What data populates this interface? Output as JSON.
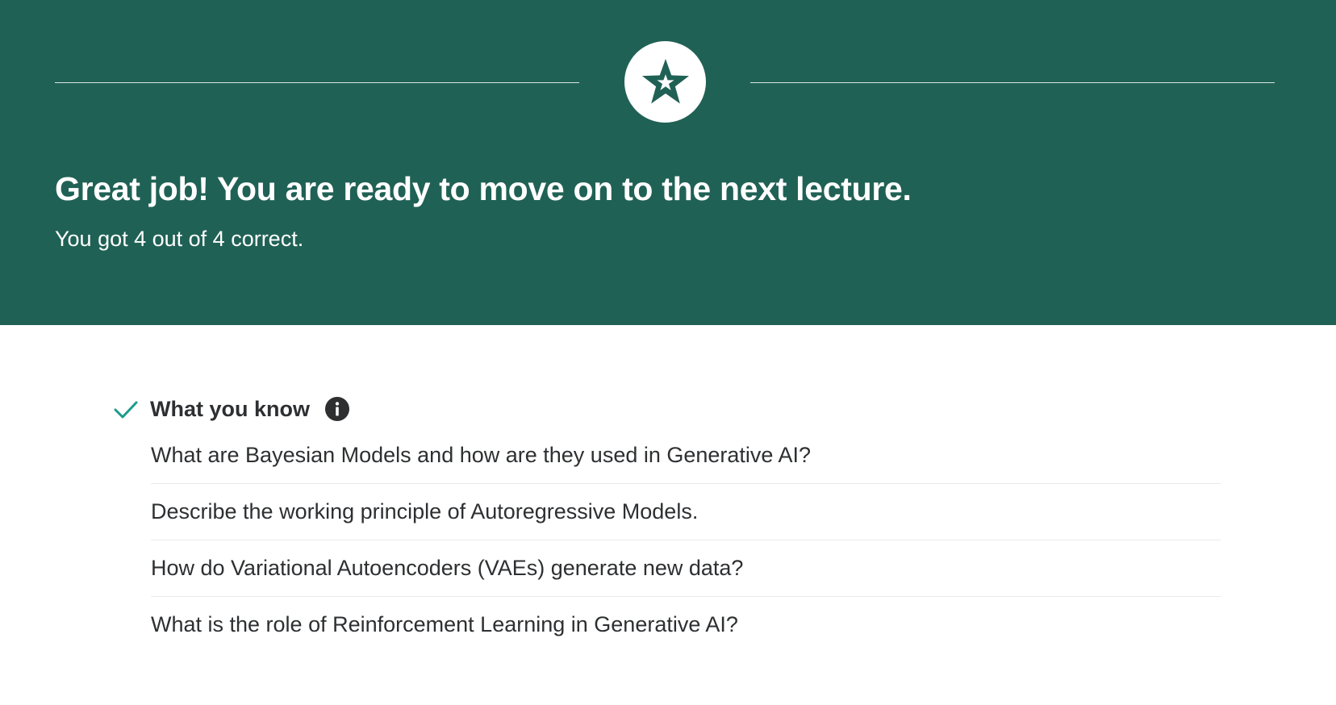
{
  "banner": {
    "background_color": "#206155",
    "icon": "star-icon",
    "title": "Great job! You are ready to move on to the next lecture.",
    "subtitle": "You got 4 out of 4 correct."
  },
  "results": {
    "section_title": "What you know",
    "section_icon": "check-icon",
    "info_icon": "info-icon",
    "accent_color": "#1e9b8a",
    "questions": [
      "What are Bayesian Models and how are they used in Generative AI?",
      "Describe the working principle of Autoregressive Models.",
      "How do Variational Autoencoders (VAEs) generate new data?",
      "What is the role of Reinforcement Learning in Generative AI?"
    ]
  }
}
